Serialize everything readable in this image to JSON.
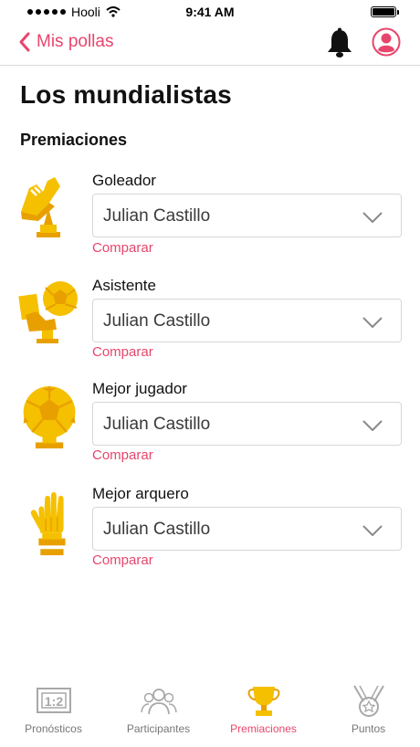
{
  "status_bar": {
    "carrier": "Hooli",
    "time": "9:41 AM"
  },
  "nav": {
    "back_label": "Mis pollas",
    "icons": [
      "chevron-left-icon",
      "bell-icon",
      "user-avatar-icon"
    ]
  },
  "page": {
    "title": "Los mundialistas",
    "section_title": "Premiaciones"
  },
  "awards": [
    {
      "label": "Goleador",
      "icon": "golden-boot-icon",
      "selected": "Julian Castillo",
      "compare": "Comparar"
    },
    {
      "label": "Asistente",
      "icon": "assist-trophy-icon",
      "selected": "Julian Castillo",
      "compare": "Comparar"
    },
    {
      "label": "Mejor jugador",
      "icon": "golden-ball-icon",
      "selected": "Julian Castillo",
      "compare": "Comparar"
    },
    {
      "label": "Mejor arquero",
      "icon": "golden-glove-icon",
      "selected": "Julian Castillo",
      "compare": "Comparar"
    }
  ],
  "tabs": [
    {
      "label": "Pronósticos",
      "icon": "scoreboard-icon",
      "active": false
    },
    {
      "label": "Participantes",
      "icon": "participants-icon",
      "active": false
    },
    {
      "label": "Premiaciones",
      "icon": "trophy-icon",
      "active": true
    },
    {
      "label": "Puntos",
      "icon": "medal-icon",
      "active": false
    }
  ],
  "colors": {
    "accent": "#e8456c",
    "gold": "#f5c000",
    "gold_dark": "#e8a000",
    "inactive": "#9a9a9a"
  }
}
